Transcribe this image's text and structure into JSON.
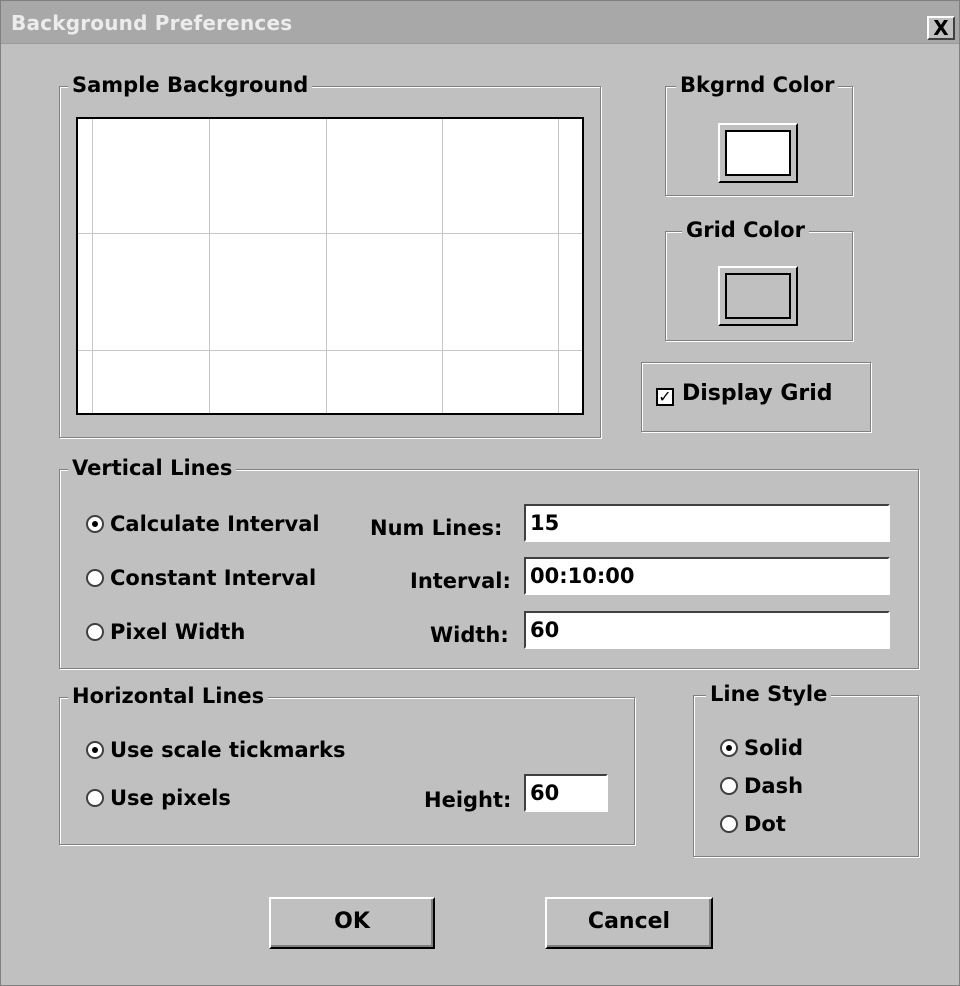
{
  "window": {
    "title": "Background Preferences",
    "close_label": "X"
  },
  "sample": {
    "legend": "Sample Background"
  },
  "bkgrnd_color": {
    "legend": "Bkgrnd Color",
    "color": "#ffffff"
  },
  "grid_color": {
    "legend": "Grid Color",
    "color": "#c0c0c0"
  },
  "display_grid": {
    "label": "Display Grid",
    "checked": true,
    "check_mark": "✓"
  },
  "vertical_lines": {
    "legend": "Vertical Lines",
    "options": [
      "Calculate Interval",
      "Constant Interval",
      "Pixel Width"
    ],
    "selected": "Calculate Interval",
    "num_lines_label": "Num Lines:",
    "num_lines_value": "15",
    "interval_label": "Interval:",
    "interval_value": "00:10:00",
    "width_label": "Width:",
    "width_value": "60"
  },
  "horizontal_lines": {
    "legend": "Horizontal Lines",
    "options": [
      "Use scale tickmarks",
      "Use pixels"
    ],
    "selected": "Use scale tickmarks",
    "height_label": "Height:",
    "height_value": "60"
  },
  "line_style": {
    "legend": "Line Style",
    "options": [
      "Solid",
      "Dash",
      "Dot"
    ],
    "selected": "Solid"
  },
  "buttons": {
    "ok": "OK",
    "cancel": "Cancel"
  },
  "colors": {
    "face": "#c0c0c0",
    "grid_line": "#c6c6c6"
  }
}
